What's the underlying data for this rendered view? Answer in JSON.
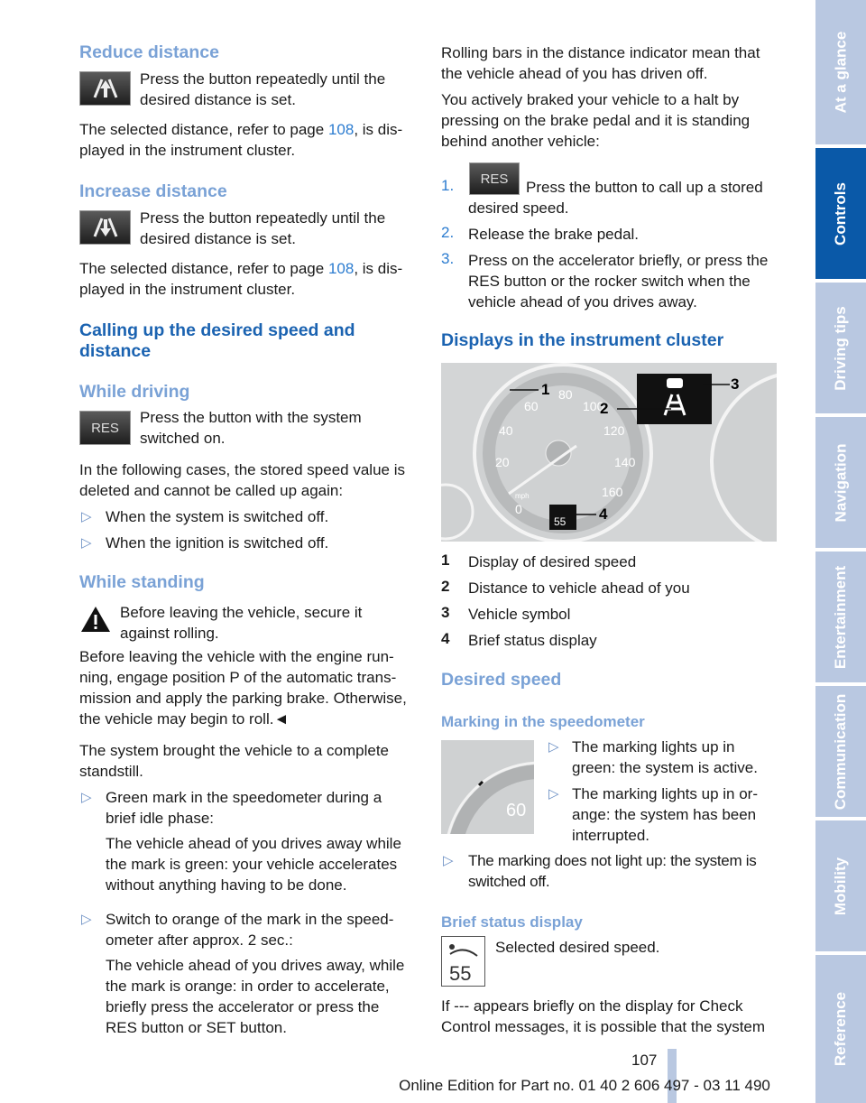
{
  "left": {
    "reduce": {
      "heading": "Reduce distance",
      "text": "Press the button repeatedly until the\ndesired distance is set.",
      "para_a": "The selected distance, refer to page ",
      "page": "108",
      "para_b": ", is dis-\nplayed in the instrument cluster."
    },
    "increase": {
      "heading": "Increase distance",
      "text": "Press the button repeatedly until the\ndesired distance is set.",
      "para_a": "The selected distance, refer to page ",
      "page": "108",
      "para_b": ", is dis-\nplayed in the instrument cluster."
    },
    "calling_heading": "Calling up the desired speed and\ndistance",
    "driving": {
      "heading": "While driving",
      "res_label": "RES",
      "text": "Press the button with the system\nswitched on.",
      "para": "In the following cases, the stored speed value is\ndeleted and cannot be called up again:",
      "bullets": [
        "When the system is switched off.",
        "When the ignition is switched off."
      ]
    },
    "standing": {
      "heading": "While standing",
      "warning": "Before leaving the vehicle, secure it\nagainst rolling.",
      "para1": "Before leaving the vehicle with the engine run-\nning, engage position P of the automatic trans-\nmission and apply the parking brake. Otherwise,\nthe vehicle may begin to roll.◄",
      "para2": "The system brought the vehicle to a complete\nstandstill.",
      "bullets": [
        {
          "text": "Green mark in the speedometer during a\nbrief idle phase:",
          "sub": "The vehicle ahead of you drives away while\nthe mark is green: your vehicle accelerates\nwithout anything having to be done."
        },
        {
          "text": "Switch to orange of the mark in the speed-\nometer after approx. 2 sec.:",
          "sub": "The vehicle ahead of you drives away, while\nthe mark is orange: in order to accelerate,\nbriefly press the accelerator or press the\nRES button or SET button."
        }
      ]
    }
  },
  "right": {
    "para1": "Rolling bars in the distance indicator mean that\nthe vehicle ahead of you has driven off.",
    "para2": "You actively braked your vehicle to a halt by\npressing on the brake pedal and it is standing\nbehind another vehicle:",
    "steps": [
      {
        "n": "1.",
        "res_label": "RES",
        "text": "Press the button to call up a stored",
        "text2": "desired speed."
      },
      {
        "n": "2.",
        "text": "Release the brake pedal."
      },
      {
        "n": "3.",
        "text": "Press on the accelerator briefly, or press the\nRES button or the rocker switch when the\nvehicle ahead of you drives away."
      }
    ],
    "displays_heading": "Displays in the instrument cluster",
    "figure": {
      "callouts": [
        "1",
        "2",
        "3",
        "4"
      ],
      "speed_mph": [
        "0",
        "20",
        "40",
        "60",
        "80",
        "100",
        "120",
        "140",
        "160"
      ],
      "mph_label": "mph",
      "status_value": "55"
    },
    "legend": [
      {
        "n": "1",
        "text": "Display of desired speed"
      },
      {
        "n": "2",
        "text": "Distance to vehicle ahead of you"
      },
      {
        "n": "3",
        "text": "Vehicle symbol"
      },
      {
        "n": "4",
        "text": "Brief status display"
      }
    ],
    "desired_heading": "Desired speed",
    "marking": {
      "heading": "Marking in the speedometer",
      "figure_value": "60",
      "bullets": [
        "The marking lights up in\ngreen: the system is active.",
        "The marking lights up in or-\nange: the system has been\ninterrupted.",
        "The marking does not light up: the system is\nswitched off."
      ]
    },
    "brief": {
      "heading": "Brief status display",
      "icon_value": "55",
      "text": "Selected desired speed.",
      "para": "If --- appears briefly on the display for Check\nControl messages, it is possible that the system"
    }
  },
  "tabs": [
    "At a glance",
    "Controls",
    "Driving tips",
    "Navigation",
    "Entertainment",
    "Communication",
    "Mobility",
    "Reference"
  ],
  "active_tab": "Controls",
  "footer": {
    "page_number": "107",
    "edition": "Online Edition for Part no. 01 40 2 606 497 - 03 11 490"
  },
  "colors": {
    "heading_dark": "#1b63b1",
    "heading_light": "#7aa2d6",
    "tab": "#b9c8e1",
    "tab_active": "#0a59a8",
    "link": "#2c7cd0"
  }
}
